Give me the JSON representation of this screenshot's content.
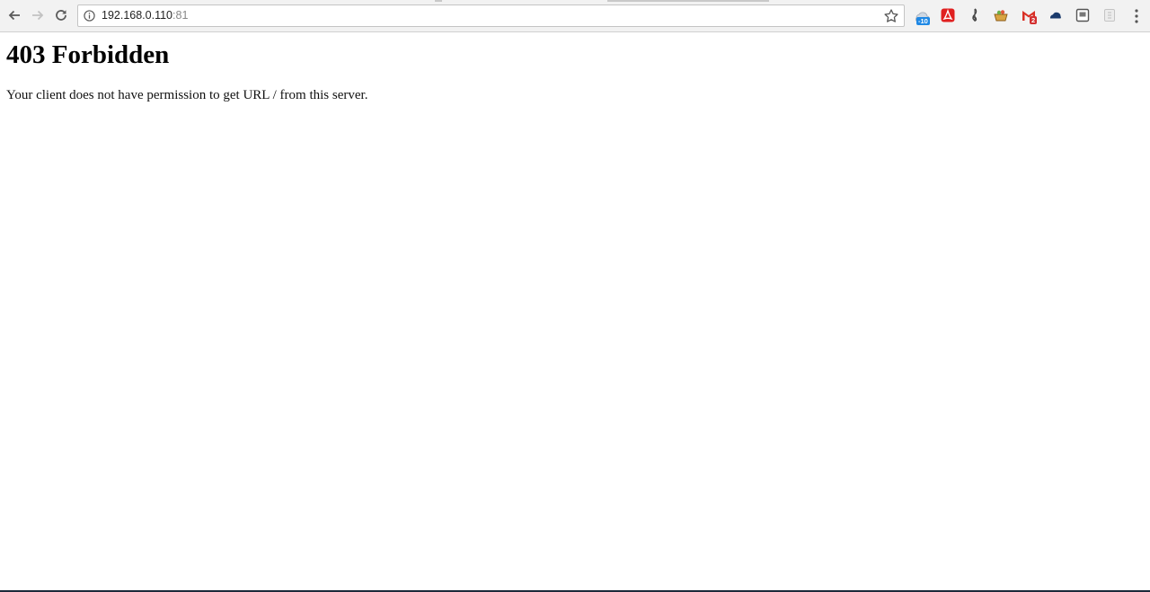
{
  "browser": {
    "url_host": "192.168.0.110",
    "url_port": ":81",
    "extensions": [
      {
        "name": "weather-extension-icon",
        "badge": "-10",
        "badge_color": "#1e88e5"
      },
      {
        "name": "acrobat-extension-icon",
        "badge": "",
        "badge_color": ""
      },
      {
        "name": "music-extension-icon",
        "badge": "",
        "badge_color": ""
      },
      {
        "name": "basket-extension-icon",
        "badge": "",
        "badge_color": ""
      },
      {
        "name": "gmail-extension-icon",
        "badge": "2",
        "badge_color": "#d32f2f"
      },
      {
        "name": "cloud-extension-icon",
        "badge": "",
        "badge_color": ""
      },
      {
        "name": "box-extension-icon",
        "badge": "",
        "badge_color": ""
      },
      {
        "name": "grey-extension-icon",
        "badge": "",
        "badge_color": ""
      }
    ]
  },
  "page": {
    "heading": "403 Forbidden",
    "message": "Your client does not have permission to get URL / from this server."
  },
  "colors": {
    "toolbar_bg": "#f2f2f2",
    "page_bg": "#ffffff",
    "acrobat_red": "#e02020",
    "gmail_red": "#d93025"
  }
}
